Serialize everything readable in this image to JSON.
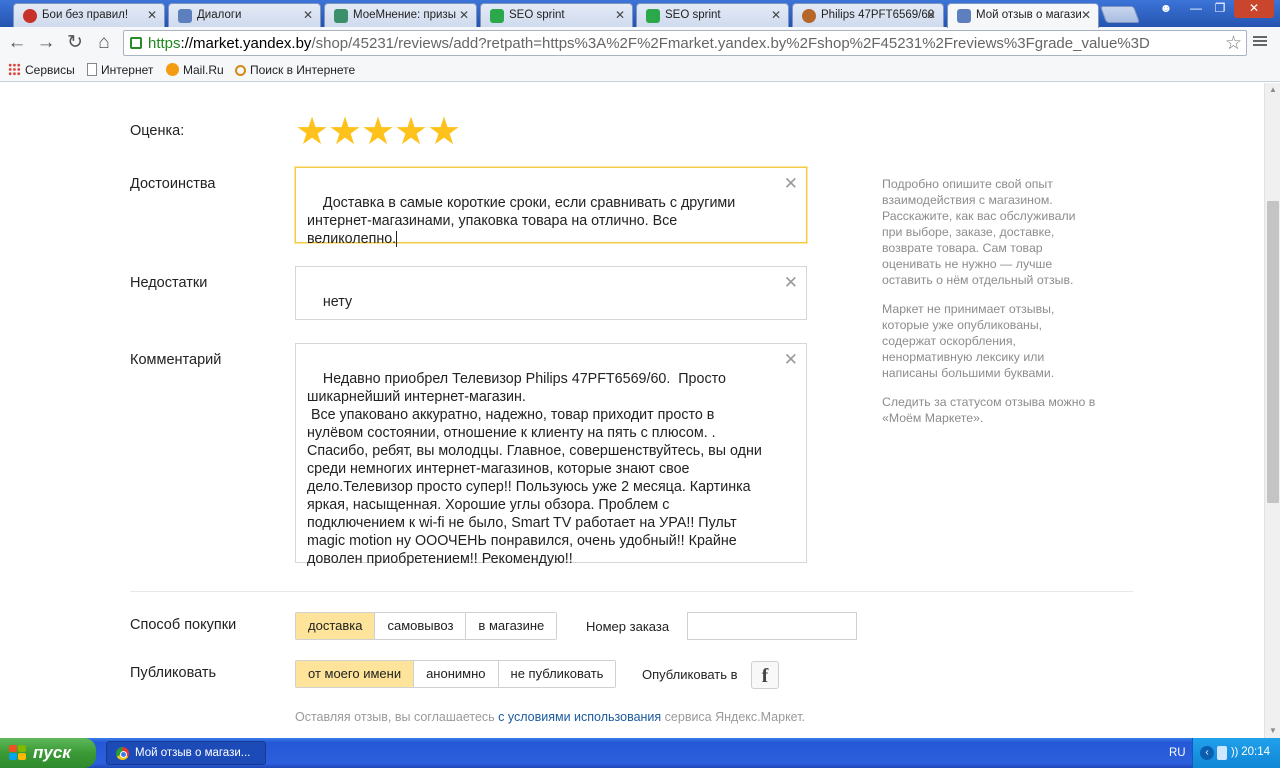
{
  "browser": {
    "tabs": [
      {
        "title": "Бои без правил!",
        "icon_color": "#c7312a"
      },
      {
        "title": "Диалоги",
        "icon_color": "#5d7fbe"
      },
      {
        "title": "МоеМнение: призы",
        "icon_color": "#3b8f6a"
      },
      {
        "title": "SEO sprint",
        "icon_color": "#2aa84a"
      },
      {
        "title": "SEO sprint",
        "icon_color": "#2aa84a"
      },
      {
        "title": "Philips 47PFT6569/60",
        "icon_color": "#b5662a"
      },
      {
        "title": "Мой отзыв о магази",
        "icon_color": "#5d7fbe"
      }
    ],
    "url_https": "https",
    "url_host": "://market.yandex.by",
    "url_rest": "/shop/45231/reviews/add?retpath=https%3A%2F%2Fmarket.yandex.by%2Fshop%2F45231%2Freviews%3Fgrade_value%3D",
    "bookmarks": [
      "Сервисы",
      "Интернет",
      "Mail.Ru",
      "Поиск в Интернете"
    ]
  },
  "review": {
    "rating_label": "Оценка:",
    "rating_value": 5,
    "rating_max": 5,
    "pros_label": "Достоинства",
    "pros_value": "Доставка в самые короткие сроки, если сравнивать с другими интернет-магазинами, упаковка товара на отлично. Все великолепно.",
    "cons_label": "Недостатки",
    "cons_value": "нету",
    "comment_label": "Комментарий",
    "comment_value": "Недавно приобрел Телевизор Philips 47PFT6569/60.  Просто шикарнейший интернет-магазин.\n Все упаковано аккуратно, надежно, товар приходит просто в нулёвом состоянии, отношение к клиенту на пять с плюсом. . Спасибо, ребят, вы молодцы. Главное, совершенствуйтесь, вы одни среди немногих интернет-магазинов, которые знают свое дело.Телевизор просто супер!! Пользуюсь уже 2 месяца. Картинка яркая, насыщенная. Хорошие углы обзора. Проблем с подключением к wi-fi не было, Smart TV работает на УРА!! Пульт magic motion ну ОООЧЕНЬ понравился, очень удобный!! Крайне доволен приобретением!! Рекомендую!!"
  },
  "hints": [
    "Подробно опишите свой опыт взаимодействия с магазином. Расскажите, как вас обслуживали при выборе, заказе, доставке, возврате товара. Сам товар оценивать не нужно — лучше оставить о нём отдельный отзыв.",
    "Маркет не принимает отзывы, которые уже опубликованы, содержат оскорбления, ненормативную лексику или написаны большими буквами.",
    "Следить за статусом отзыва можно в «Моём Маркете»."
  ],
  "purchase": {
    "label": "Способ покупки",
    "options": [
      "доставка",
      "самовывоз",
      "в магазине"
    ],
    "selected": "доставка",
    "order_label": "Номер заказа",
    "order_value": ""
  },
  "publish": {
    "label": "Публиковать",
    "options": [
      "от моего имени",
      "анонимно",
      "не публиковать"
    ],
    "selected": "от моего имени",
    "share_label": "Опубликовать в",
    "share_icon": "facebook-icon"
  },
  "terms": {
    "before": "Оставляя отзыв, вы соглашаетесь ",
    "link": "с условиями использования",
    "after": " сервиса Яндекс.Маркет."
  },
  "taskbar": {
    "start_label": "пуск",
    "window_title": "Мой отзыв о магази...",
    "language": "RU",
    "time": "20:14"
  }
}
